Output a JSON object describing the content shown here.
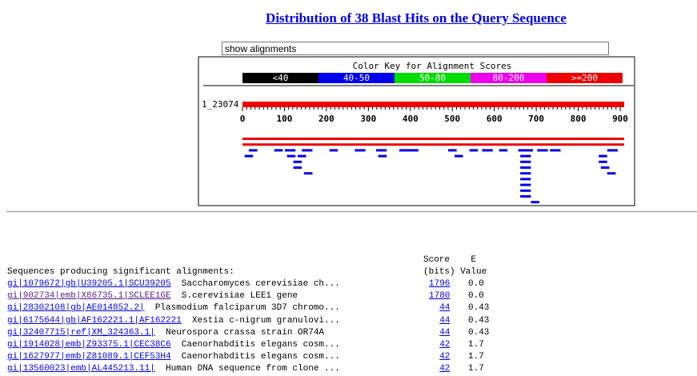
{
  "title": "Distribution of 38 Blast Hits on the Query Sequence",
  "select": {
    "value": "show alignments"
  },
  "color_key": {
    "title": "Color Key for Alignment Scores",
    "items": [
      {
        "label": "<40",
        "color": "#000000"
      },
      {
        "label": "40-50",
        "color": "#0000ee"
      },
      {
        "label": "50-80",
        "color": "#00dd00"
      },
      {
        "label": "80-200",
        "color": "#ee00ee"
      },
      {
        "label": ">=200",
        "color": "#ee0000"
      }
    ]
  },
  "query": {
    "label": "1_23074",
    "length": 900,
    "ticks": [
      "0",
      "100",
      "200",
      "300",
      "400",
      "500",
      "600",
      "700",
      "800",
      "900"
    ]
  },
  "hits_graph": [
    {
      "start": 0,
      "end": 900,
      "row": 0,
      "color": "#ee0000"
    },
    {
      "start": 0,
      "end": 900,
      "row": 1,
      "color": "#ee0000"
    },
    {
      "start": 15,
      "end": 35,
      "row": 2,
      "color": "#0000ee"
    },
    {
      "start": 75,
      "end": 95,
      "row": 2,
      "color": "#0000ee"
    },
    {
      "start": 100,
      "end": 125,
      "row": 2,
      "color": "#0000ee"
    },
    {
      "start": 140,
      "end": 165,
      "row": 2,
      "color": "#0000ee"
    },
    {
      "start": 205,
      "end": 225,
      "row": 2,
      "color": "#0000ee"
    },
    {
      "start": 265,
      "end": 290,
      "row": 2,
      "color": "#0000ee"
    },
    {
      "start": 315,
      "end": 340,
      "row": 2,
      "color": "#0000ee"
    },
    {
      "start": 370,
      "end": 415,
      "row": 2,
      "color": "#0000ee"
    },
    {
      "start": 485,
      "end": 505,
      "row": 2,
      "color": "#0000ee"
    },
    {
      "start": 535,
      "end": 555,
      "row": 2,
      "color": "#0000ee"
    },
    {
      "start": 565,
      "end": 590,
      "row": 2,
      "color": "#0000ee"
    },
    {
      "start": 605,
      "end": 625,
      "row": 2,
      "color": "#0000ee"
    },
    {
      "start": 650,
      "end": 685,
      "row": 2,
      "color": "#0000ee"
    },
    {
      "start": 695,
      "end": 720,
      "row": 2,
      "color": "#0000ee"
    },
    {
      "start": 725,
      "end": 750,
      "row": 2,
      "color": "#0000ee"
    },
    {
      "start": 860,
      "end": 885,
      "row": 2,
      "color": "#0000ee"
    },
    {
      "start": 5,
      "end": 25,
      "row": 3,
      "color": "#0000ee"
    },
    {
      "start": 105,
      "end": 125,
      "row": 3,
      "color": "#0000ee"
    },
    {
      "start": 130,
      "end": 150,
      "row": 3,
      "color": "#0000ee"
    },
    {
      "start": 320,
      "end": 340,
      "row": 3,
      "color": "#0000ee"
    },
    {
      "start": 500,
      "end": 520,
      "row": 3,
      "color": "#0000ee"
    },
    {
      "start": 655,
      "end": 680,
      "row": 3,
      "color": "#0000ee"
    },
    {
      "start": 840,
      "end": 860,
      "row": 3,
      "color": "#0000ee"
    },
    {
      "start": 120,
      "end": 140,
      "row": 4,
      "color": "#0000ee"
    },
    {
      "start": 655,
      "end": 680,
      "row": 4,
      "color": "#0000ee"
    },
    {
      "start": 840,
      "end": 860,
      "row": 4,
      "color": "#0000ee"
    },
    {
      "start": 120,
      "end": 140,
      "row": 5,
      "color": "#0000ee"
    },
    {
      "start": 655,
      "end": 680,
      "row": 5,
      "color": "#0000ee"
    },
    {
      "start": 845,
      "end": 865,
      "row": 5,
      "color": "#0000ee"
    },
    {
      "start": 145,
      "end": 165,
      "row": 6,
      "color": "#0000ee"
    },
    {
      "start": 655,
      "end": 680,
      "row": 6,
      "color": "#0000ee"
    },
    {
      "start": 860,
      "end": 880,
      "row": 6,
      "color": "#0000ee"
    },
    {
      "start": 655,
      "end": 680,
      "row": 7,
      "color": "#0000ee"
    },
    {
      "start": 655,
      "end": 680,
      "row": 8,
      "color": "#0000ee"
    },
    {
      "start": 655,
      "end": 680,
      "row": 9,
      "color": "#0000ee"
    },
    {
      "start": 655,
      "end": 680,
      "row": 10,
      "color": "#0000ee"
    },
    {
      "start": 680,
      "end": 700,
      "row": 11,
      "color": "#0000ee"
    }
  ],
  "table": {
    "header_line1": "Score    E",
    "header_line2_left": "Sequences producing significant alignments:",
    "header_line2_right": "(bits) Value",
    "rows": [
      {
        "id": "gi|1079672|gb|U39205.1|SCU39205",
        "desc": "Saccharomyces cerevisiae ch...",
        "score": "1796",
        "evalue": "0.0",
        "visited": false
      },
      {
        "id": "gi|902734|emb|X86735.1|SCLEE1GE",
        "desc": "S.cerevisiae LEE1 gene",
        "score": "1780",
        "evalue": "0.0",
        "visited": true
      },
      {
        "id": "gi|28302108|gb|AE014852.2|",
        "desc": "Plasmodium falciparum 3D7 chromo...",
        "score": "44",
        "evalue": "0.43",
        "visited": false
      },
      {
        "id": "gi|6175644|gb|AF162221.1|AF162221",
        "desc": "Xestia c-nigrum granulovi...",
        "score": "44",
        "evalue": "0.43",
        "visited": false
      },
      {
        "id": "gi|32407715|ref|XM_324363.1|",
        "desc": "Neurospora crassa strain OR74A",
        "score": "44",
        "evalue": "0.43",
        "visited": false
      },
      {
        "id": "gi|1914028|emb|Z93375.1|CEC38C6",
        "desc": "Caenorhabditis elegans cosm...",
        "score": "42",
        "evalue": "1.7",
        "visited": false
      },
      {
        "id": "gi|1627977|emb|Z81089.1|CEF53H4",
        "desc": "Caenorhabditis elegans cosm...",
        "score": "42",
        "evalue": "1.7",
        "visited": false
      },
      {
        "id": "gi|13560023|emb|AL445213.11|",
        "desc": "Human DNA sequence from clone ...",
        "score": "42",
        "evalue": "1.7",
        "visited": false
      }
    ]
  }
}
